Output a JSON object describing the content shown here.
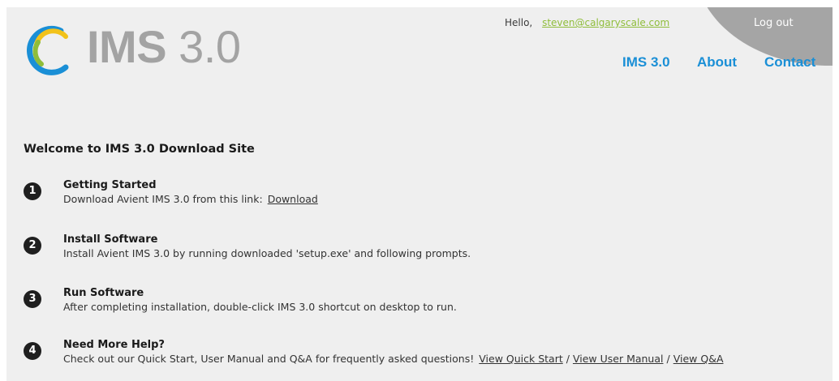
{
  "header": {
    "logo": {
      "bold": "IMS",
      "light": " 3.0"
    },
    "greeting": "Hello,",
    "user_email": "steven@calgaryscale.com",
    "logout_label": "Log out",
    "nav": [
      {
        "label": "IMS 3.0"
      },
      {
        "label": "About"
      },
      {
        "label": "Contact"
      }
    ]
  },
  "main": {
    "heading": "Welcome to IMS 3.0 Download Site",
    "steps": [
      {
        "number": "1",
        "title": "Getting Started",
        "text": "Download Avient IMS 3.0 from this link:",
        "link": "Download"
      },
      {
        "number": "2",
        "title": "Install Software",
        "text": "Install Avient IMS 3.0 by running downloaded 'setup.exe' and following prompts."
      },
      {
        "number": "3",
        "title": "Run Software",
        "text": "After completing installation, double-click IMS 3.0 shortcut on desktop to run."
      },
      {
        "number": "4",
        "title": "Need More Help?",
        "text": "Check out our Quick Start, User Manual and Q&A for frequently asked questions!",
        "links": [
          "View Quick Start",
          "View User Manual",
          "View Q&A"
        ],
        "separator": "/"
      }
    ]
  },
  "colors": {
    "background": "#efefef",
    "nav_link": "#1a8fd6",
    "email_link": "#8fbd3a",
    "logout_shape": "#a5a5a5",
    "logo_text": "#a3a3a3",
    "step_badge": "#1f1f1f"
  }
}
